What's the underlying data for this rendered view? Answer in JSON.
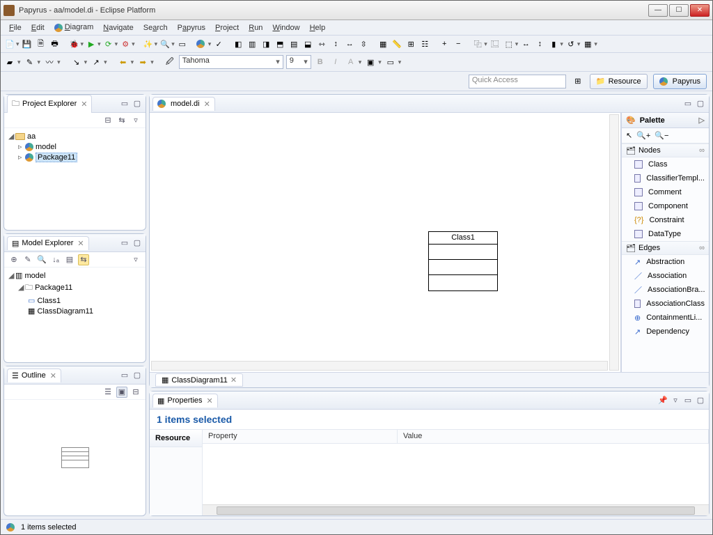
{
  "window": {
    "title": "Papyrus - aa/model.di - Eclipse Platform"
  },
  "menu": {
    "file": "File",
    "edit": "Edit",
    "diagram": "Diagram",
    "navigate": "Navigate",
    "search": "Search",
    "papyrus": "Papyrus",
    "project": "Project",
    "run": "Run",
    "window": "Window",
    "help": "Help"
  },
  "font": {
    "family": "Tahoma",
    "size": "9"
  },
  "quick_access_placeholder": "Quick Access",
  "perspectives": {
    "resource": "Resource",
    "papyrus": "Papyrus"
  },
  "project_explorer": {
    "title": "Project Explorer",
    "root": "aa",
    "items": [
      "model",
      "Package11"
    ],
    "selected": "Package11"
  },
  "model_explorer": {
    "title": "Model Explorer",
    "root": "model",
    "package": "Package11",
    "children": [
      "Class1",
      "ClassDiagram11"
    ]
  },
  "outline": {
    "title": "Outline"
  },
  "editor": {
    "tab": "model.di",
    "inner_tab": "ClassDiagram11",
    "class_name": "Class1"
  },
  "palette": {
    "title": "Palette",
    "drawer_nodes": "Nodes",
    "drawer_edges": "Edges",
    "nodes": [
      "Class",
      "ClassifierTempl...",
      "Comment",
      "Component",
      "Constraint",
      "DataType"
    ],
    "edges": [
      "Abstraction",
      "Association",
      "AssociationBra...",
      "AssociationClass",
      "ContainmentLi...",
      "Dependency"
    ]
  },
  "properties": {
    "title": "Properties",
    "heading": "1 items selected",
    "sidetab": "Resource",
    "col_property": "Property",
    "col_value": "Value"
  },
  "status": "1 items selected"
}
